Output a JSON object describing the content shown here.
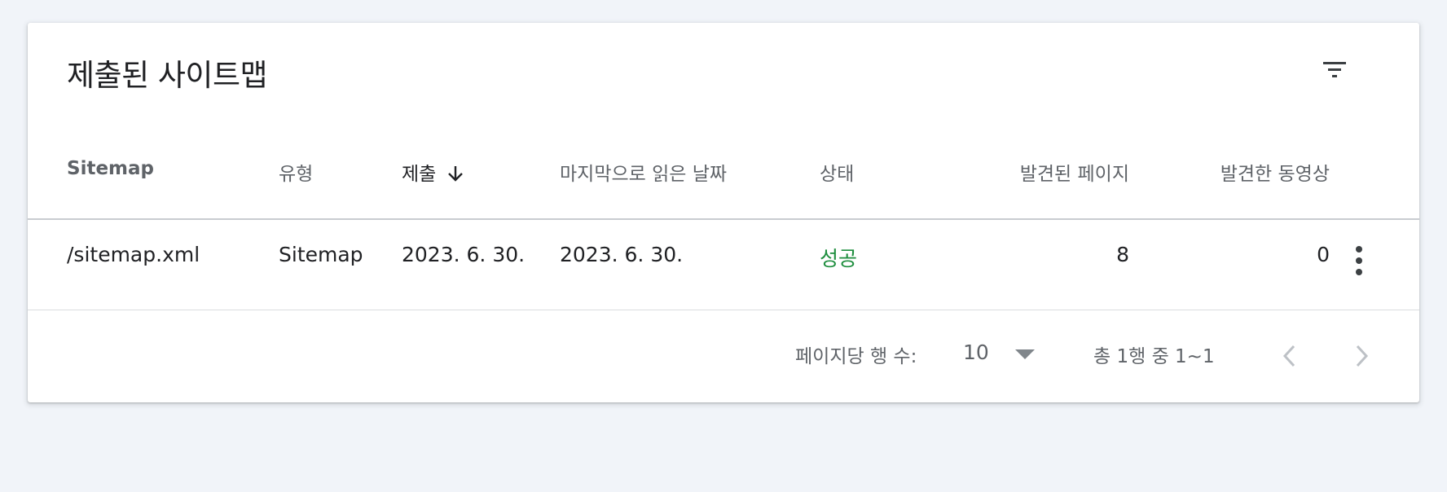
{
  "card": {
    "title": "제출된 사이트맵",
    "filter_icon": "filter-list-icon"
  },
  "table": {
    "columns": [
      "Sitemap",
      "유형",
      "제출",
      "마지막으로 읽은 날짜",
      "상태",
      "발견된 페이지",
      "발견한 동영상"
    ],
    "sorted_column": "제출",
    "sort_direction": "descending",
    "sort_icon": "arrow-down-icon",
    "rows": [
      {
        "sitemap": "/sitemap.xml",
        "type": "Sitemap",
        "submitted": "2023. 6. 30.",
        "last_read": "2023. 6. 30.",
        "status": "성공",
        "pages_found": "8",
        "videos_found": "0",
        "menu_icon": "more-vert-icon"
      }
    ]
  },
  "pagination": {
    "rows_per_page_label": "페이지당 행 수:",
    "rows_per_page_value": "10",
    "range_label": "총 1행 중 1~1",
    "prev_icon": "chevron-left-icon",
    "next_icon": "chevron-right-icon"
  },
  "colors": {
    "background": "#f1f4f9",
    "card": "#ffffff",
    "status_success": "#1e8e3e",
    "header_text": "#5f6368",
    "disabled_icon": "#bdc1c6"
  }
}
